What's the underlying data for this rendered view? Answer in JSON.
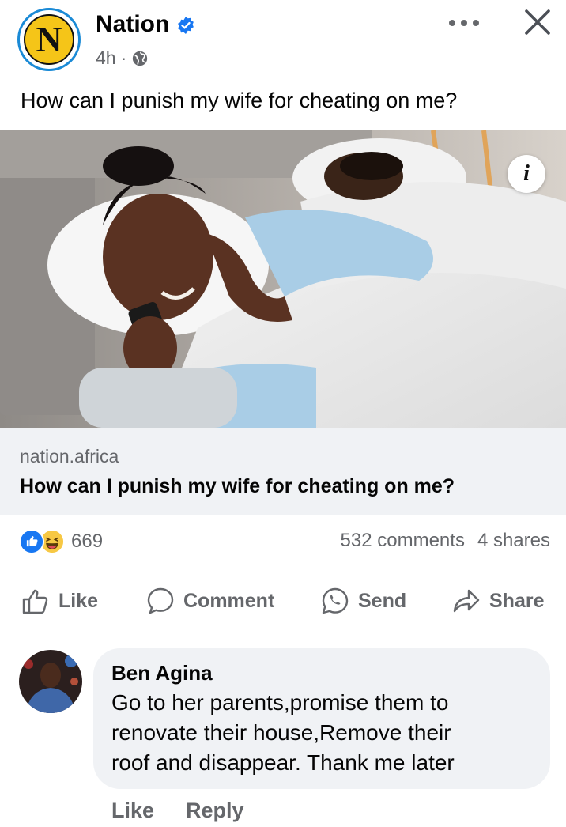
{
  "post": {
    "page_name": "Nation",
    "logo_letter": "N",
    "time": "4h",
    "separator": "·",
    "text": "How can I punish my wife for cheating on me?",
    "image_info": "i"
  },
  "link_preview": {
    "domain": "nation.africa",
    "title": "How can I punish my wife for cheating on me?"
  },
  "engagement": {
    "reaction_count": "669",
    "comments": "532 comments",
    "shares": "4 shares",
    "reaction_icons": [
      "like-icon",
      "haha-icon"
    ]
  },
  "actions": {
    "like": "Like",
    "comment": "Comment",
    "send": "Send",
    "share": "Share"
  },
  "comment": {
    "author": "Ben Agina",
    "lines": [
      "Go to her parents,promise them to",
      "renovate their house,Remove their",
      "roof and disappear.  Thank me later"
    ],
    "like": "Like",
    "reply": "Reply"
  },
  "colors": {
    "brand_blue": "#1877f2",
    "secondary_text": "#65676b",
    "bubble_bg": "#f0f2f5",
    "logo_yellow": "#f5c518"
  }
}
